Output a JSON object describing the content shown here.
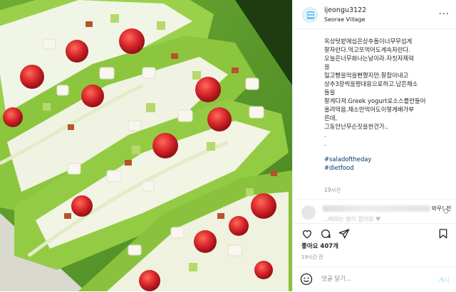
{
  "header": {
    "username": "ijeongu3122",
    "location": "Seorae Village",
    "more_label": "···"
  },
  "caption": {
    "lines": [
      "옥상텃밭에심은상추들이너무무섭게",
      "잘자란다.먹고또먹어도계속자란다.",
      "오늘은너무화나는날이라.자칫자제력",
      "을",
      "잃고빵을먹을뻔했지만.잘참아내고",
      "상추3장씩을평대용으로하고.남은채소",
      "들을",
      "잘게다져.Greek yogurt로소스를만들어",
      "올려먹음.채소만먹어도이렇게배가부",
      "른데,",
      "그동안난무슨짓을한건가..",
      ".",
      "."
    ],
    "hashtags": [
      "#saladoftheday",
      "#dietfood"
    ]
  },
  "post_time_short": "19시간",
  "comment": {
    "text_visible_end": "와우! 전",
    "text_visible_line2": "...버리는 밤이 업이요 ♥"
  },
  "actions": {
    "icons": [
      "heart-icon",
      "comment-icon",
      "share-icon",
      "bookmark-icon"
    ]
  },
  "likes": "좋아요 407개",
  "post_time": "19시간 전",
  "add_comment": {
    "placeholder": "댓글 달기...",
    "post_label": "게시"
  },
  "colors": {
    "hashtag": "#00376b",
    "post_button": "#b2dffc",
    "lettuce": "#8cc63f",
    "tomato": "#d6262b"
  }
}
